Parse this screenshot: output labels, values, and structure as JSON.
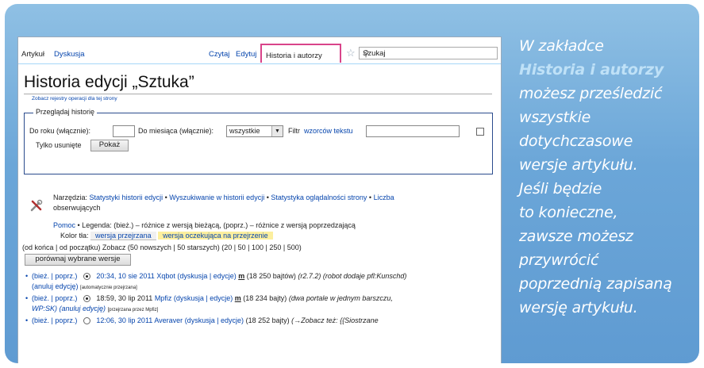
{
  "tabs": {
    "article": "Artykuł",
    "discussion": "Dyskusja",
    "read": "Czytaj",
    "edit": "Edytuj",
    "history": "Historia i autorzy",
    "search_value": "Szukaj"
  },
  "page": {
    "title": "Historia edycji „Sztuka”",
    "subtitle": "Zobacz rejestry operacji dla tej strony"
  },
  "filter": {
    "legend": "Przeglądaj historię",
    "year_label": "Do roku (włącznie):",
    "month_label": "Do miesiąca (włącznie):",
    "month_value": "wszystkie",
    "filter_label": "Filtr",
    "filter_link": "wzorców tekstu",
    "only_deleted": "Tylko usunięte",
    "show_button": "Pokaż"
  },
  "tools": {
    "prefix": "Narzędzia:",
    "link1": "Statystyki historii edycji",
    "link2": "Wyszukiwanie w historii edycji",
    "link3": "Statystyka oglądalności strony",
    "link4": "Liczba",
    "link4b": "obserwujących"
  },
  "legend": {
    "help": "Pomoc",
    "text": "• Legenda: (bież.) – różnice z wersją bieżącą, (poprz.) – różnice z wersją poprzedzającą",
    "bg_label": "Kolor tła:",
    "reviewed": "wersja przejrzana",
    "pending": "wersja oczekująca na przejrzenie"
  },
  "nav": {
    "line": "(od końca | od początku) Zobacz (50 nowszych | 50 starszych) (20 | 50 | 100 | 250 | 500)",
    "compare_button": "porównaj wybrane wersje"
  },
  "rows": [
    {
      "line1_a": "(bież. | poprz.)",
      "date": "20:34, 10 sie 2011",
      "user": "Xqbot",
      "user_links": "(dyskusja | edycje)",
      "minor": "m",
      "size": "(18 250 bajtów)",
      "comment": "(r2.7.2) (robot dodaje pfl:Kunschd)",
      "line2": "(anuluj edycję)",
      "tag": "[automatycznie przejrzana]"
    },
    {
      "line1_a": "(bież. | poprz.)",
      "date": "18:59, 30 lip 2011",
      "user": "Mpfiz",
      "user_links": "(dyskusja | edycje)",
      "minor": "m",
      "size": "(18 234 bajty)",
      "comment": "(dwa portale w jednym barszczu,",
      "line2": "WP:SK) (anuluj edycję)",
      "tag": "[przejrzana przez Mpfiz]"
    },
    {
      "line1_a": "(bież. | poprz.)",
      "date": "12:06, 30 lip 2011",
      "user": "Averaver",
      "user_links": "(dyskusja | edycje)",
      "minor": "",
      "size": "(18 252 bajty)",
      "comment": "(→Zobacz też: {{Siostrzane"
    }
  ],
  "caption": {
    "l1": "W zakładce",
    "l2": "Historia i autorzy",
    "l3": "możesz prześledzić",
    "l4": "wszystkie",
    "l5": "dotychczasowe",
    "l6": "wersje artykułu.",
    "l7": "Jeśli będzie",
    "l8": "to konieczne,",
    "l9": "zawsze możesz",
    "l10": "przywrócić",
    "l11": "poprzednią zapisaną",
    "l12": "wersję artykułu."
  },
  "colors": {
    "frame": "#6ba6d8",
    "highlight_tab": "#d9448a",
    "caption_highlight": "#bfe1f7",
    "link": "#0645ad",
    "pending_bg": "#fcef9e"
  }
}
